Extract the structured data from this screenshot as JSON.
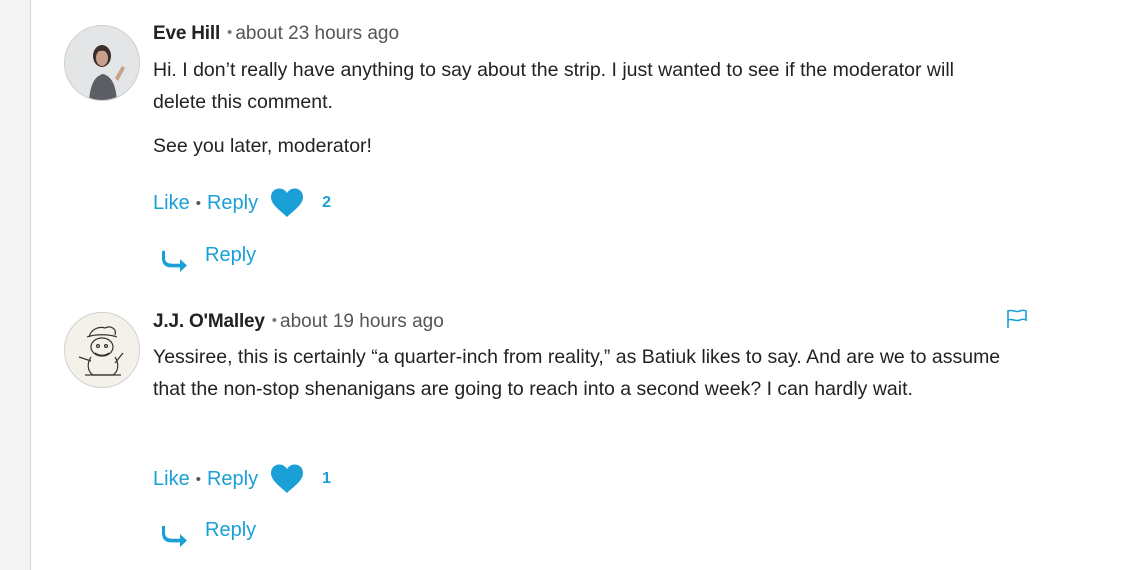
{
  "comments": [
    {
      "author": "Eve Hill",
      "time": "about 23 hours ago",
      "paragraphs": [
        "Hi. I don’t really have anything to say about the strip. I just wanted to see if the moderator will delete this comment.",
        "See you later, moderator!"
      ],
      "like_label": "Like",
      "reply_label": "Reply",
      "likes": "2",
      "reply_button_label": "Reply"
    },
    {
      "author": "J.J. O'Malley",
      "time": "about 19 hours ago",
      "paragraphs": [
        "Yessiree, this is certainly “a quarter-inch from reality,” as Batiuk likes to say. And are we to assume that the non-stop shenanigans are going to reach into a second week? I can hardly wait."
      ],
      "like_label": "Like",
      "reply_label": "Reply",
      "likes": "1",
      "reply_button_label": "Reply"
    }
  ],
  "separator": "•",
  "icons": {
    "like": "heart-icon",
    "reply": "reply-arrow-icon",
    "flag": "flag-icon"
  },
  "colors": {
    "link": "#1a9fd6",
    "text": "#222222",
    "muted": "#555555"
  }
}
